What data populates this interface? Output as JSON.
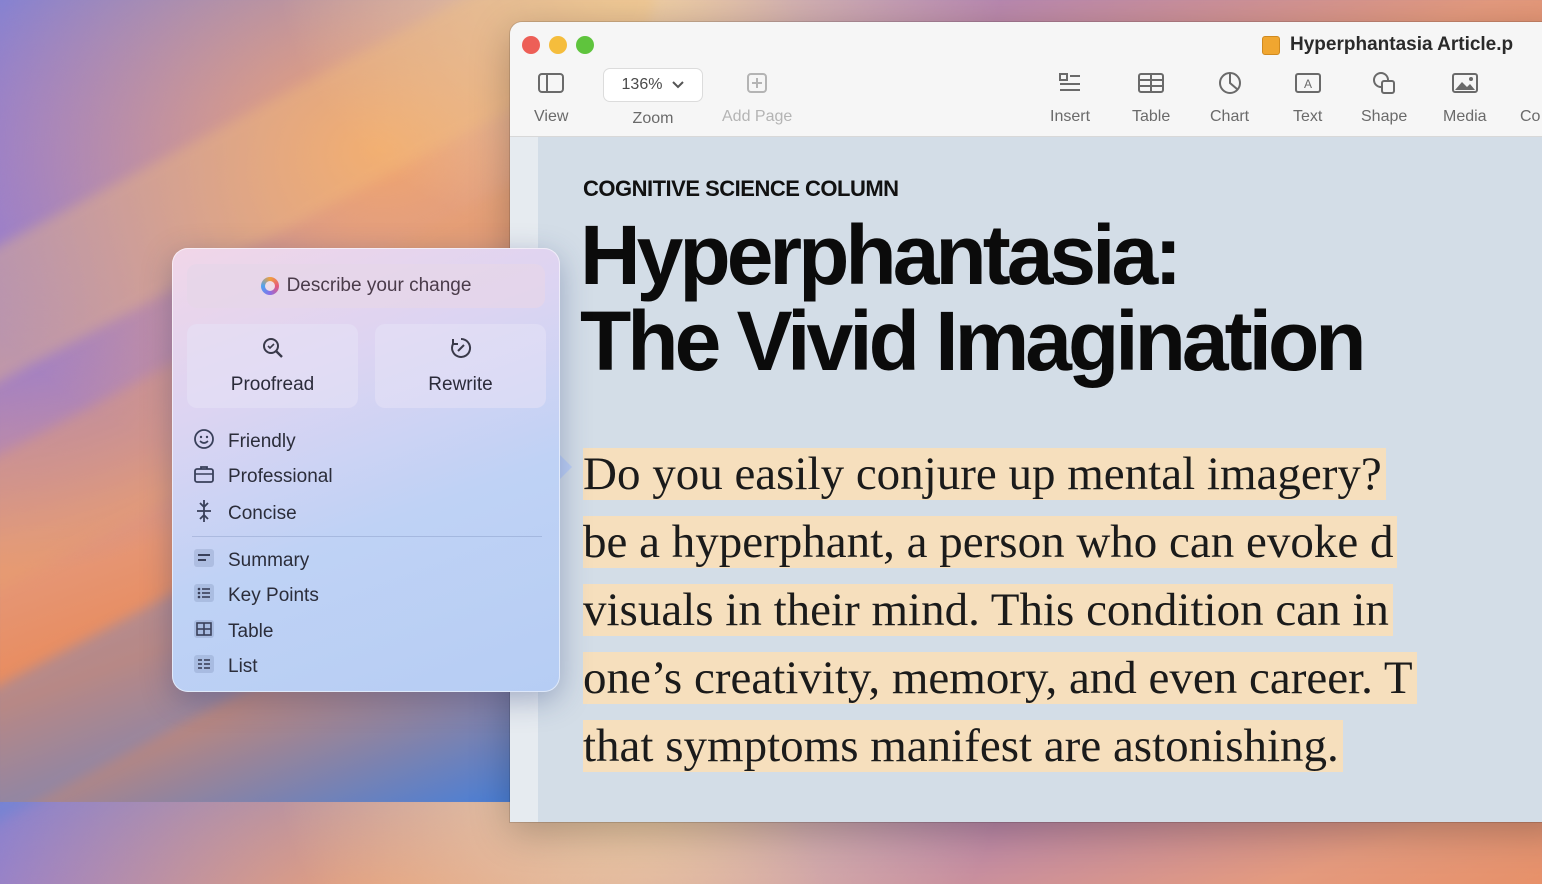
{
  "window": {
    "document_title": "Hyperphantasia Article.p",
    "toolbar": {
      "view_label": "View",
      "zoom_value": "136%",
      "zoom_label": "Zoom",
      "add_page_label": "Add Page",
      "insert_label": "Insert",
      "table_label": "Table",
      "chart_label": "Chart",
      "text_label": "Text",
      "shape_label": "Shape",
      "media_label": "Media",
      "comment_label": "Co"
    }
  },
  "document": {
    "kicker": "COGNITIVE SCIENCE COLUMN",
    "headline_line1": "Hyperphantasia:",
    "headline_line2": "The Vivid Imagination",
    "body_lines": [
      "Do you easily conjure up mental imagery? ",
      "be a hyperphant, a person who can evoke d",
      "visuals in their mind. This condition can in",
      "one’s creativity, memory, and even career. T",
      "that symptoms manifest are astonishing."
    ],
    "highlight_color": "#f6dfbd"
  },
  "writing_tools": {
    "describe_placeholder": "Describe your change",
    "proofread_label": "Proofread",
    "rewrite_label": "Rewrite",
    "tone_items": [
      "Friendly",
      "Professional",
      "Concise"
    ],
    "format_items": [
      "Summary",
      "Key Points",
      "Table",
      "List"
    ]
  }
}
